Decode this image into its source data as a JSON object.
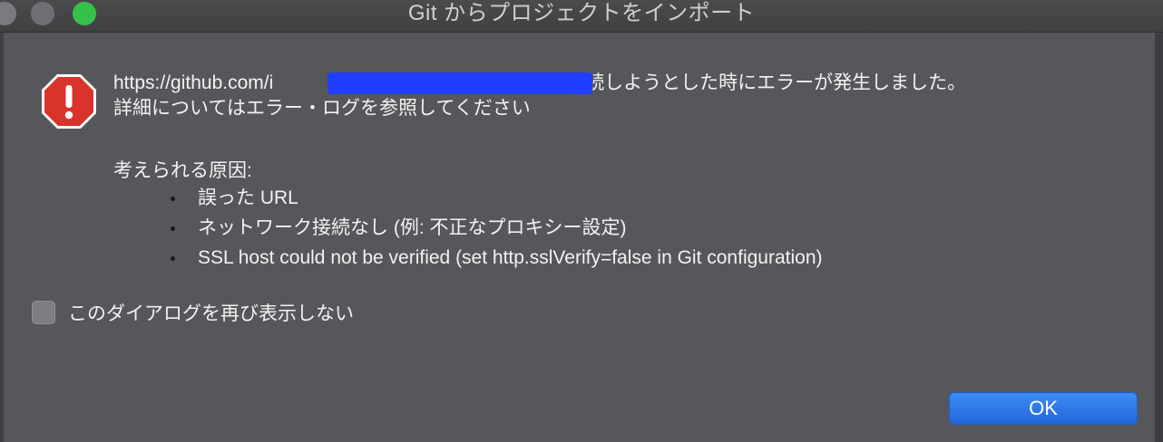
{
  "window": {
    "title": "Git からプロジェクトをインポート"
  },
  "icons": {
    "alert": "error-octagon-icon",
    "close": "window-close-icon",
    "minimize": "window-minimize-icon",
    "maximize": "window-maximize-icon"
  },
  "message": {
    "line1_prefix": "https://github.com/i",
    "line1_suffix": ".git に接続しようとした時にエラーが発生しました。",
    "line2": "詳細についてはエラー・ログを参照してください"
  },
  "causes": {
    "title": "考えられる原因:",
    "items": [
      "誤った URL",
      "ネットワーク接続なし (例: 不正なプロキシー設定)",
      "SSL host could not be verified (set http.sslVerify=false in Git configuration)"
    ]
  },
  "checkbox": {
    "label": "このダイアログを再び表示しない"
  },
  "buttons": {
    "ok": "OK"
  },
  "colors": {
    "background": "#55575a",
    "accent": "#2d7ae8",
    "error": "#d9342b",
    "redaction": "#1f3eff"
  }
}
